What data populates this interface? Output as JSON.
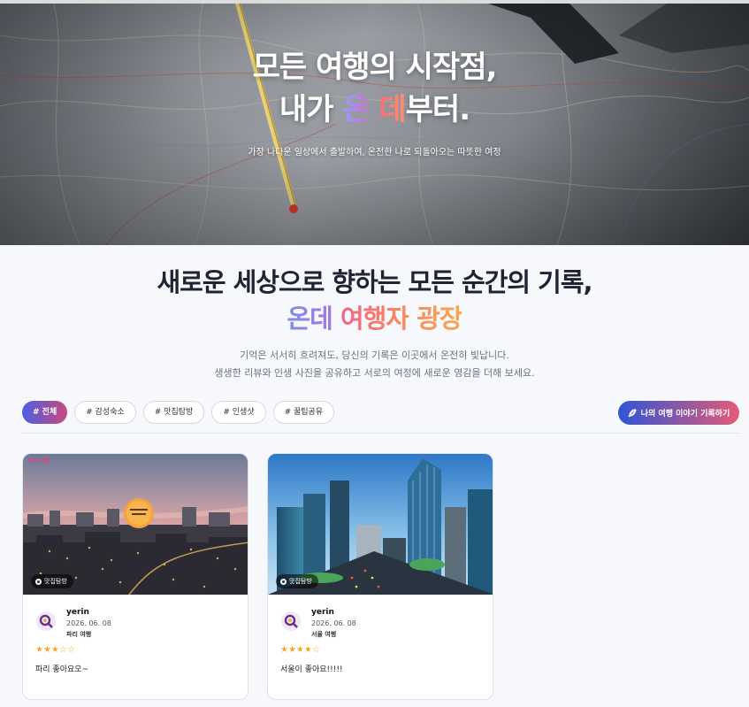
{
  "hero": {
    "title_line1": "모든 여행의 시작점,",
    "title_line2_a": "내가 ",
    "title_line2_b": "온",
    "title_line2_c": " ",
    "title_line2_d": "데",
    "title_line2_e": "부터.",
    "subtitle": "가장 나다운 일상에서 출발하여, 온전한 나로 되돌아오는 따뜻한 여정"
  },
  "section": {
    "title": "새로운 세상으로 향하는 모든 순간의 기록,",
    "title2_a": "온데",
    "title2_b": " 여행자",
    "title2_c": " 광장",
    "desc_line1": "기억은 서서히 흐려져도, 당신의 기록은 이곳에서 온전히 빛납니다.",
    "desc_line2": "생생한 리뷰와 인생 사진을 공유하고 서로의 여정에 새로운 영감을 더해 보세요."
  },
  "filters": [
    {
      "label": "# 전체",
      "active": true
    },
    {
      "label": "# 감성숙소",
      "active": false
    },
    {
      "label": "# 맛집탐방",
      "active": false
    },
    {
      "label": "# 인생샷",
      "active": false
    },
    {
      "label": "# 꿀팁공유",
      "active": false
    }
  ],
  "write_button": {
    "label": "나의 여행 이야기 기록하기",
    "icon": "feather-icon"
  },
  "cards": [
    {
      "badge": "맛집탐방",
      "overlay_text": "파리 여행",
      "user": "yerin",
      "date": "2026. 06. 08",
      "trip": "파리 여행",
      "rating": 3,
      "stars": "★★★☆☆",
      "text": "파리 좋아요오~"
    },
    {
      "badge": "맛집탐방",
      "user": "yerin",
      "date": "2026. 06. 08",
      "trip": "서울 여행",
      "rating": 4,
      "stars": "★★★★☆",
      "text": "서울이 좋아요!!!!!"
    }
  ],
  "colors": {
    "accent_blue": "#2f55d4",
    "accent_pink": "#e65a78",
    "star": "#f0a92a"
  }
}
